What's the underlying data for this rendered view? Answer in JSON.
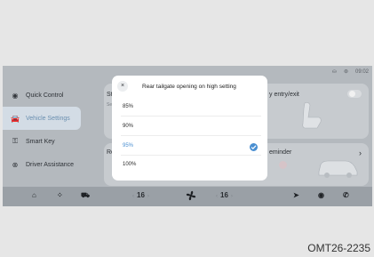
{
  "status_bar": {
    "time": "09:02",
    "icons": [
      "profile-icon",
      "signal-icon"
    ]
  },
  "sidebar": {
    "items": [
      {
        "label": "Quick Control",
        "icon": "quick-control-icon",
        "active": false
      },
      {
        "label": "Vehicle Settings",
        "icon": "car-icon",
        "active": true
      },
      {
        "label": "Smart Key",
        "icon": "key-icon",
        "active": false
      },
      {
        "label": "Driver Assistance",
        "icon": "steering-icon",
        "active": false
      }
    ]
  },
  "cards": {
    "card1": {
      "label_left": "St",
      "label_right": "y entry/exit",
      "sub": "Se"
    },
    "card2": {
      "label_left": "Re",
      "label_right": "eminder",
      "chevron": "›"
    }
  },
  "dialog": {
    "close": "×",
    "title": "Rear tailgate opening on high setting",
    "options": [
      "85%",
      "90%",
      "95%",
      "100%"
    ],
    "selected_index": 2
  },
  "bottom_bar": {
    "left_temp": "16",
    "right_temp": "16",
    "temp_left_arrow": "‹",
    "temp_right_arrow": "›"
  },
  "caption": "OMT26-2235",
  "colors": {
    "accent": "#4a8fd1",
    "screen_bg": "#b4b9be",
    "dialog_bg": "#ffffff"
  }
}
